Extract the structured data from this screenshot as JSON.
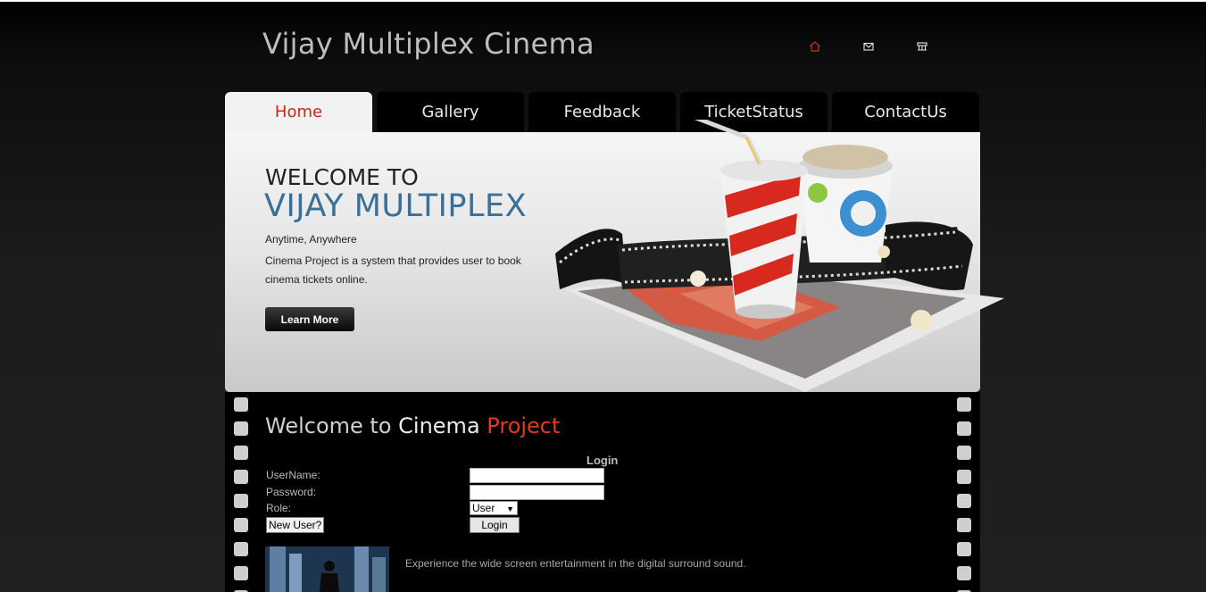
{
  "header": {
    "title": "Vijay Multiplex Cinema",
    "icons": [
      "home-icon",
      "mail-icon",
      "sitemap-icon"
    ]
  },
  "nav": {
    "tabs": [
      {
        "label": "Home",
        "active": true
      },
      {
        "label": "Gallery",
        "active": false
      },
      {
        "label": "Feedback",
        "active": false
      },
      {
        "label": "TicketStatus",
        "active": false
      },
      {
        "label": "ContactUs",
        "active": false
      }
    ]
  },
  "banner": {
    "welcome_line1": "WELCOME TO",
    "welcome_line2": "VIJAY MULTIPLEX",
    "tagline": "Anytime, Anywhere",
    "description": "Cinema Project is a system that provides user to book cinema tickets online.",
    "button_label": "Learn More"
  },
  "main": {
    "title_part1": "Welcome to",
    "title_part2": "Cinema",
    "title_part3": "Project",
    "login": {
      "title": "Login",
      "username_label": "UserName:",
      "username_value": "",
      "password_label": "Password:",
      "password_value": "",
      "role_label": "Role:",
      "role_selected": "User",
      "new_user_label": "New User?",
      "login_button_label": "Login"
    },
    "promo_text": "Experience the wide screen entertainment in the digital surround sound."
  },
  "colors": {
    "accent_red": "#c8281a",
    "title_blue": "#3a6f96",
    "project_red": "#e03b24",
    "background": "#000000"
  }
}
